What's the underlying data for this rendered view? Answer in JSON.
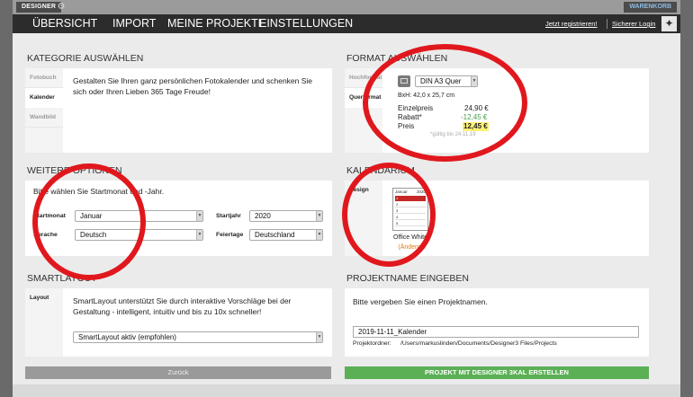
{
  "app": {
    "brand": "DESIGNER",
    "cart_label": "WARENKORB"
  },
  "nav": {
    "items": [
      "ÜBERSICHT",
      "IMPORT",
      "MEINE PROJEKTE",
      "EINSTELLUNGEN"
    ],
    "register_link": "Jetzt registrieren!",
    "login_link": "Sicherer Login"
  },
  "kategorie": {
    "title": "KATEGORIE AUSWÄHLEN",
    "tabs": [
      "Fotobuch",
      "Kalender",
      "Wandbild"
    ],
    "active_tab": "Kalender",
    "description": "Gestalten Sie Ihren ganz persönlichen Fotokalender und schenken Sie sich oder Ihren Lieben 365 Tage Freude!"
  },
  "format": {
    "title": "FORMAT AUSWÄHLEN",
    "tabs": [
      "Hochformat",
      "Querformat"
    ],
    "selected": "DIN A3 Quer",
    "dimensions": "BxH: 42,0 x 25,7 cm",
    "price_rows": [
      {
        "label": "Einzelpreis",
        "value": "24,90 €"
      },
      {
        "label": "Rabatt*",
        "value": "-12,45 €"
      },
      {
        "label": "Preis",
        "value": "12,45 €"
      }
    ],
    "valid_note": "*gültig bis 24.11.19"
  },
  "optionen": {
    "title": "WEITERE OPTIONEN",
    "intro": "Bitte wählen Sie Startmonat und -Jahr.",
    "start_month_label": "Startmonat",
    "start_month_value": "Januar",
    "start_year_label": "Startjahr",
    "start_year_value": "2020",
    "language_label": "Sprache",
    "language_value": "Deutsch",
    "holidays_label": "Feiertage",
    "holidays_value": "Deutschland"
  },
  "kalendarium": {
    "title": "KALENDARIUM",
    "tab": "Design",
    "thumb_month": "Januar",
    "thumb_year": "2020",
    "thumb_rows": [
      "1",
      "2",
      "3",
      "4",
      "5"
    ],
    "design_name": "Office White",
    "change_link": "(Ändern)"
  },
  "smartlayout": {
    "title": "SMARTLAYOUT",
    "tab": "Layout",
    "description": "SmartLayout unterstützt Sie durch interaktive Vorschläge bei der Gestaltung - intelligent, intuitiv und bis zu 10x schneller!",
    "select_value": "SmartLayout aktiv (empfohlen)"
  },
  "projektname": {
    "title": "PROJEKTNAME EINGEBEN",
    "prompt": "Bitte vergeben Sie einen Projektnamen.",
    "name_value": "2019-11-11_Kalender",
    "folder_label": "Projektordner:",
    "folder_path": "/Users/markuslinden/Documents/Designer3 Files/Projects"
  },
  "actions": {
    "back": "Zurück",
    "create": "PROJEKT MIT DESIGNER 3KAL ERSTELLEN"
  },
  "colors": {
    "highlight_circle": "#e0181d",
    "create_button": "#5bb055",
    "discount": "#43a047",
    "price_highlight": "#fff176"
  }
}
